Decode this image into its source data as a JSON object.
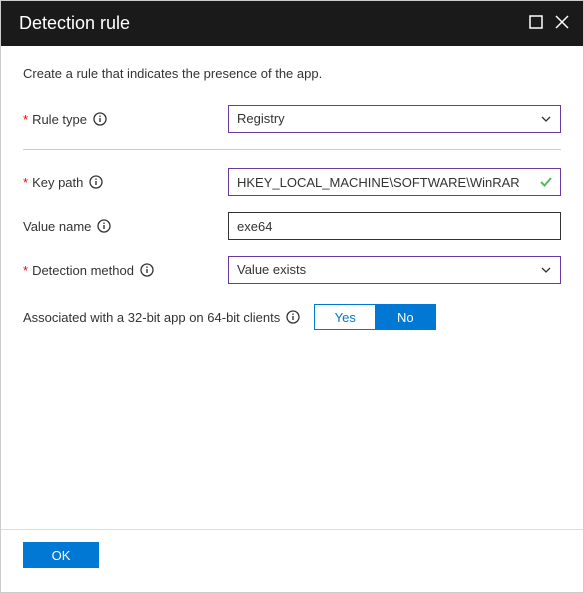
{
  "header": {
    "title": "Detection rule"
  },
  "description": "Create a rule that indicates the presence of the app.",
  "form": {
    "ruleType": {
      "label": "Rule type",
      "value": "Registry",
      "required": true
    },
    "keyPath": {
      "label": "Key path",
      "value": "HKEY_LOCAL_MACHINE\\SOFTWARE\\WinRAR",
      "required": true,
      "validated": true
    },
    "valueName": {
      "label": "Value name",
      "value": "exe64",
      "required": false
    },
    "detectionMethod": {
      "label": "Detection method",
      "value": "Value exists",
      "required": true
    },
    "associated32bit": {
      "label": "Associated with a 32-bit app on 64-bit clients",
      "options": {
        "yes": "Yes",
        "no": "No"
      },
      "selected": "no"
    }
  },
  "footer": {
    "okLabel": "OK"
  }
}
